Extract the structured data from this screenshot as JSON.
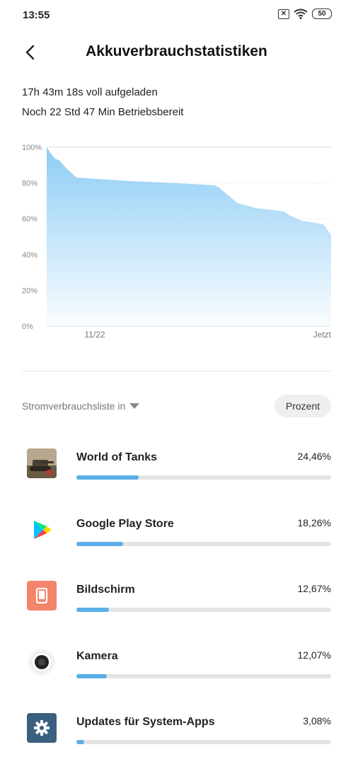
{
  "status_bar": {
    "time": "13:55",
    "battery": "50"
  },
  "header": {
    "title": "Akkuverbrauchstatistiken"
  },
  "info": {
    "charged": "17h 43m 18s voll aufgeladen",
    "remaining": "Noch 22 Std 47 Min Betriebsbereit"
  },
  "chart_data": {
    "type": "area",
    "y_ticks": [
      "100%",
      "80%",
      "60%",
      "40%",
      "20%",
      "0%"
    ],
    "x_ticks": [
      "11/22",
      "Jetzt"
    ],
    "ylim": [
      0,
      100
    ],
    "grid": true,
    "color": "#8ecdf5",
    "x": [
      0,
      0.012,
      0.03,
      0.045,
      0.07,
      0.105,
      0.3,
      0.5,
      0.59,
      0.605,
      0.67,
      0.74,
      0.79,
      0.835,
      0.855,
      0.9,
      0.95,
      0.975,
      1.0
    ],
    "values": [
      100,
      97,
      93.5,
      92.5,
      88,
      83,
      81,
      79.5,
      78.7,
      77.5,
      68.8,
      65.8,
      65,
      64,
      61.8,
      58.8,
      57.6,
      56.6,
      51
    ]
  },
  "list": {
    "label": "Stromverbrauchsliste in",
    "unit_button": "Prozent"
  },
  "apps": [
    {
      "name": "World of Tanks",
      "percent_label": "24,46%",
      "fraction": 0.2446,
      "icon": "tank-game-icon"
    },
    {
      "name": "Google Play Store",
      "percent_label": "18,26%",
      "fraction": 0.1826,
      "icon": "play-store-icon"
    },
    {
      "name": "Bildschirm",
      "percent_label": "12,67%",
      "fraction": 0.1267,
      "icon": "screen-icon"
    },
    {
      "name": "Kamera",
      "percent_label": "12,07%",
      "fraction": 0.1207,
      "icon": "camera-icon"
    },
    {
      "name": "Updates für System-Apps",
      "percent_label": "3,08%",
      "fraction": 0.0308,
      "icon": "settings-gear-icon"
    }
  ],
  "colors": {
    "accent": "#5aaee8",
    "chart_fill": "#8ecdf5",
    "track": "#e4e4e4"
  }
}
